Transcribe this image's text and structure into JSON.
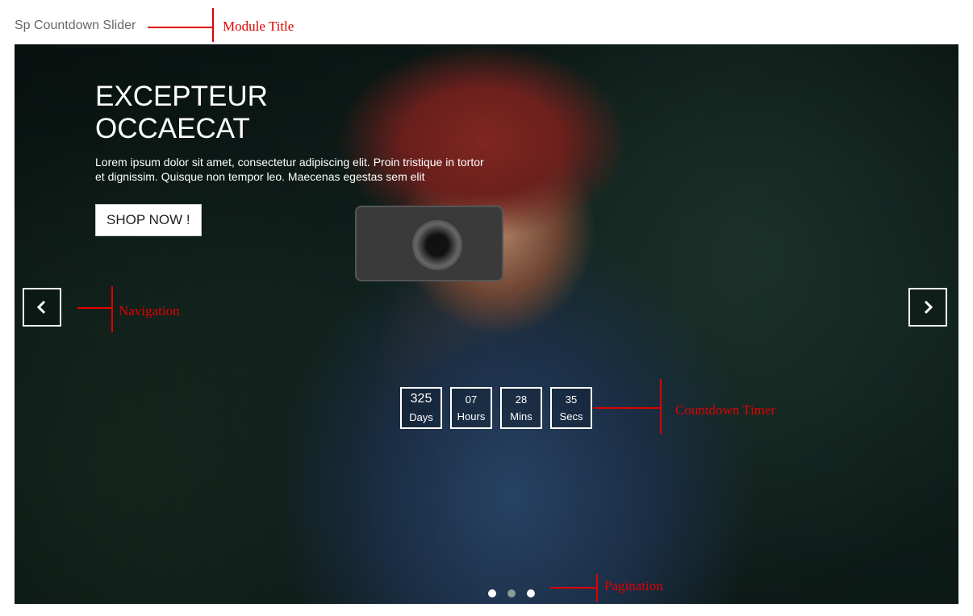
{
  "module_title": "Sp Countdown Slider",
  "annotations": {
    "module_title": "Module Title",
    "navigation": "Navigation",
    "countdown": "Countdown Timer",
    "pagination": "Pagination"
  },
  "slide": {
    "title_line1": "EXCEPTEUR",
    "title_line2": "OCCAECAT",
    "description": "Lorem ipsum dolor sit amet, consectetur adipiscing elit. Proin tristique in tortor et dignissim. Quisque non tempor leo. Maecenas egestas sem elit",
    "button_label": "SHOP NOW !"
  },
  "countdown": [
    {
      "value": "325",
      "label": "Days"
    },
    {
      "value": "07",
      "label": "Hours"
    },
    {
      "value": "28",
      "label": "Mins"
    },
    {
      "value": "35",
      "label": "Secs"
    }
  ],
  "pagination": {
    "count": 3,
    "active_index": 1
  },
  "icons": {
    "prev": "chevron-left-icon",
    "next": "chevron-right-icon"
  },
  "colors": {
    "annotation": "#e00000",
    "accent": "#ffffff"
  }
}
